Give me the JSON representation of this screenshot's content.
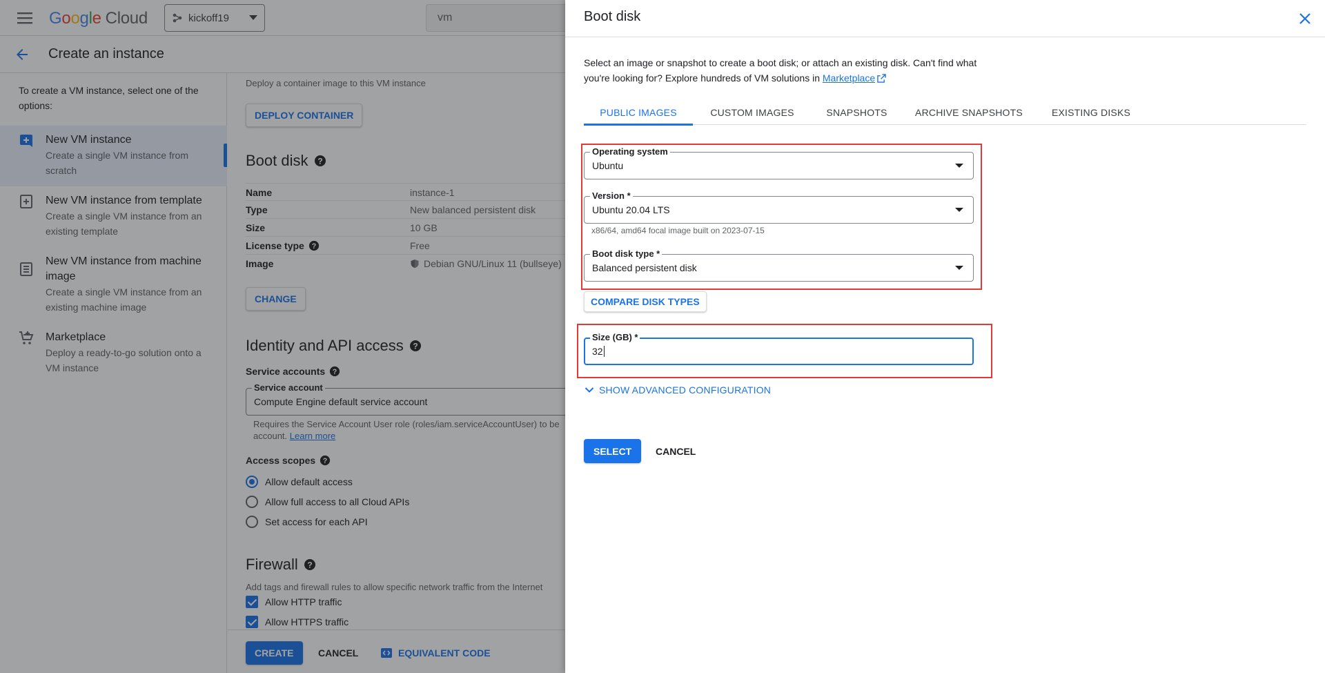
{
  "topbar": {
    "logo_letters": [
      "G",
      "o",
      "o",
      "g",
      "l",
      "e"
    ],
    "logo_cloud": "Cloud",
    "project": "kickoff19",
    "search_value": "vm"
  },
  "page": {
    "title": "Create an instance"
  },
  "leftnav": {
    "intro": "To create a VM instance, select one of the options:",
    "items": [
      {
        "title": "New VM instance",
        "desc": "Create a single VM instance from scratch",
        "icon": "add-box-icon"
      },
      {
        "title": "New VM instance from template",
        "desc": "Create a single VM instance from an existing template",
        "icon": "template-icon"
      },
      {
        "title": "New VM instance from machine image",
        "desc": "Create a single VM instance from an existing machine image",
        "icon": "machine-image-icon"
      },
      {
        "title": "Marketplace",
        "desc": "Deploy a ready-to-go solution onto a VM instance",
        "icon": "cart-icon"
      }
    ]
  },
  "main": {
    "container_desc": "Deploy a container image to this VM instance",
    "deploy_container_label": "DEPLOY CONTAINER",
    "boot_disk_title": "Boot disk",
    "boot_rows": [
      {
        "key": "Name",
        "value": "instance-1"
      },
      {
        "key": "Type",
        "value": "New balanced persistent disk"
      },
      {
        "key": "Size",
        "value": "10 GB"
      },
      {
        "key": "License type",
        "value": "Free"
      },
      {
        "key": "Image",
        "value": "Debian GNU/Linux 11 (bullseye)"
      }
    ],
    "change_label": "CHANGE",
    "identity_title": "Identity and API access",
    "service_accounts_label": "Service accounts",
    "service_account_field_label": "Service account",
    "service_account_value": "Compute Engine default service account",
    "sa_note_line1": "Requires the Service Account User role (roles/iam.serviceAccountUser) to be",
    "sa_note_line2_prefix": "account.",
    "learn_more": "Learn more",
    "access_scopes_label": "Access scopes",
    "scopes": [
      "Allow default access",
      "Allow full access to all Cloud APIs",
      "Set access for each API"
    ],
    "firewall_title": "Firewall",
    "firewall_desc": "Add tags and firewall rules to allow specific network traffic from the Internet",
    "firewall_checks": [
      "Allow HTTP traffic",
      "Allow HTTPS traffic"
    ]
  },
  "bottombar": {
    "create_label": "CREATE",
    "cancel_label": "CANCEL",
    "equivalent_code_label": "EQUIVALENT CODE"
  },
  "panel": {
    "title": "Boot disk",
    "desc_text": "Select an image or snapshot to create a boot disk; or attach an existing disk. Can't find what you're looking for? Explore hundreds of VM solutions in",
    "marketplace_link": "Marketplace",
    "tabs": [
      "PUBLIC IMAGES",
      "CUSTOM IMAGES",
      "SNAPSHOTS",
      "ARCHIVE SNAPSHOTS",
      "EXISTING DISKS"
    ],
    "os_label": "Operating system",
    "os_value": "Ubuntu",
    "version_label": "Version *",
    "version_value": "Ubuntu 20.04 LTS",
    "version_hint": "x86/64, amd64 focal image built on 2023-07-15",
    "disk_type_label": "Boot disk type *",
    "disk_type_value": "Balanced persistent disk",
    "compare_label": "COMPARE DISK TYPES",
    "size_label": "Size (GB) *",
    "size_value": "32",
    "advanced_label": "SHOW ADVANCED CONFIGURATION",
    "select_label": "SELECT",
    "cancel_label": "CANCEL"
  },
  "colors": {
    "accent": "#1a73e8",
    "highlight": "#e53935"
  }
}
